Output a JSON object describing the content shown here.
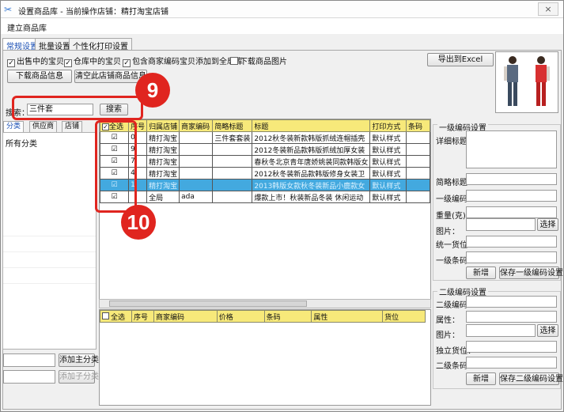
{
  "window": {
    "title": "设置商品库 - 当前操作店铺：精打淘宝店铺",
    "close_glyph": "×"
  },
  "menubar": {
    "item": "建立商品库"
  },
  "tabs": [
    "常规设置",
    "批量设置",
    "个性化打印设置"
  ],
  "options": {
    "on_sale": "出售中的宝贝",
    "in_stock": "仓库中的宝贝",
    "include_codes": "包含商家编码宝贝添加到全局库",
    "download_images": "下载商品图片"
  },
  "buttons": {
    "download_info": "下载商品信息",
    "clear_info": "清空此店铺商品信息",
    "export_excel": "导出到Excel",
    "search": "搜索",
    "add_main_category": "添加主分类",
    "add_sub_category": "添加子分类",
    "add_1": "新增",
    "save_level1": "保存一级编码设置",
    "select_1": "选择",
    "add_2": "新增",
    "save_level2": "保存二级编码设置",
    "select_2": "选择"
  },
  "search": {
    "label": "搜索：",
    "value": "三件套"
  },
  "subtabs": [
    "分类",
    "供应商",
    "店铺"
  ],
  "category_tree": {
    "root": "所有分类"
  },
  "main_grid": {
    "columns": [
      "全选",
      "序号",
      "归属店铺",
      "商家编码",
      "简略标题",
      "标题",
      "打印方式",
      "条码"
    ],
    "rows": [
      {
        "checked": true,
        "index": "0",
        "shop": "精打淘宝",
        "code": "",
        "short_title": "三件套套装",
        "title": "2012秋冬装新款韩版抓绒连帽插壳",
        "print_mode": "默认样式",
        "barcode": ""
      },
      {
        "checked": true,
        "index": "9",
        "shop": "精打淘宝",
        "code": "",
        "short_title": "",
        "title": "2012冬装新品款韩版抓绒加厚女装",
        "print_mode": "默认样式",
        "barcode": ""
      },
      {
        "checked": true,
        "index": "7",
        "shop": "精打淘宝",
        "code": "",
        "short_title": "",
        "title": "春秋冬北京青年唐娇姚装同款韩版女",
        "print_mode": "默认样式",
        "barcode": ""
      },
      {
        "checked": true,
        "index": "4",
        "shop": "精打淘宝",
        "code": "",
        "short_title": "",
        "title": "2012秋冬装新品款韩版修身女装卫",
        "print_mode": "默认样式",
        "barcode": ""
      },
      {
        "checked": true,
        "index": "1",
        "shop": "精打淘宝",
        "code": "",
        "short_title": "",
        "title": "2013韩版女款秋冬装新品小鹿款女",
        "print_mode": "默认样式",
        "barcode": ""
      },
      {
        "checked": true,
        "index": "",
        "shop": "全局",
        "code": "ada",
        "short_title": "",
        "title": "爆款上市！秋装新品冬装 休闲运动",
        "print_mode": "默认样式",
        "barcode": ""
      }
    ]
  },
  "sub_grid": {
    "columns": [
      "全选",
      "序号",
      "商家编码",
      "价格",
      "条码",
      "属性",
      "货位"
    ]
  },
  "level1": {
    "heading": "一级编码设置",
    "detail_title": "详细标题：",
    "short_title": "简略标题：",
    "code": "一级编码：",
    "weight": "重量(克)：",
    "image": "图片：",
    "location": "统一货位：",
    "barcode": "一级条码："
  },
  "level2": {
    "heading": "二级编码设置",
    "code": "二级编码：",
    "attribute": "属性：",
    "image": "图片：",
    "location": "独立货位：",
    "barcode": "二级条码："
  },
  "callouts": {
    "search_badge": "9",
    "rows_badge": "10"
  },
  "colors": {
    "accent_red": "#e0251f",
    "grid_header": "#f7e97a",
    "selected_row": "#43a9df"
  }
}
